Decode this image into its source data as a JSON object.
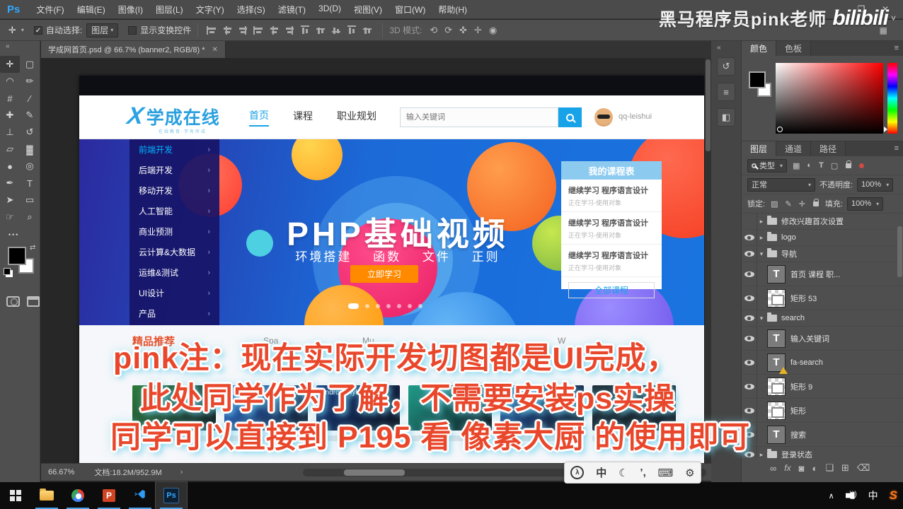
{
  "menu_bar": {
    "app_logo": "Ps",
    "items": [
      "文件(F)",
      "编辑(E)",
      "图像(I)",
      "图层(L)",
      "文字(Y)",
      "选择(S)",
      "滤镜(T)",
      "3D(D)",
      "视图(V)",
      "窗口(W)",
      "帮助(H)"
    ],
    "window_controls": [
      {
        "name": "minimize-button",
        "glyph": "–"
      },
      {
        "name": "restore-button",
        "glyph": "❐"
      },
      {
        "name": "close-button",
        "glyph": "✕"
      }
    ]
  },
  "watermark": {
    "text": "黑马程序员pink老师",
    "logo": "bilibili"
  },
  "options_bar": {
    "tool_icon": "✛",
    "auto_select_label": "自动选择:",
    "auto_select_value": "图层",
    "transform_label": "显示变换控件",
    "mode3d_label": "3D 模式:",
    "align_icons": [
      "align-top-edges-icon",
      "align-vertical-centers-icon",
      "align-bottom-edges-icon",
      "align-left-edges-icon",
      "align-horizontal-centers-icon",
      "align-right-edges-icon",
      "distribute-top-icon",
      "distribute-vertical-icon",
      "distribute-bottom-icon",
      "distribute-left-icon",
      "distribute-horizontal-icon"
    ],
    "mode3d_icons": [
      {
        "name": "rotate-3d-icon",
        "glyph": "⟲"
      },
      {
        "name": "roll-3d-icon",
        "glyph": "⟳"
      },
      {
        "name": "drag-3d-icon",
        "glyph": "✜"
      },
      {
        "name": "slide-3d-icon",
        "glyph": "✛"
      },
      {
        "name": "scale-3d-icon",
        "glyph": "◉"
      }
    ]
  },
  "toolbar": {
    "tools": [
      {
        "name": "move-tool",
        "glyph": "✛",
        "selected": true
      },
      {
        "name": "rectangular-marquee-tool",
        "glyph": "▢"
      },
      {
        "name": "lasso-tool",
        "glyph": "◠"
      },
      {
        "name": "quick-selection-tool",
        "glyph": "✏"
      },
      {
        "name": "crop-tool",
        "glyph": "#"
      },
      {
        "name": "eyedropper-tool",
        "glyph": "⁄"
      },
      {
        "name": "healing-brush-tool",
        "glyph": "✚"
      },
      {
        "name": "brush-tool",
        "glyph": "✎"
      },
      {
        "name": "clone-stamp-tool",
        "glyph": "⊥"
      },
      {
        "name": "history-brush-tool",
        "glyph": "↺"
      },
      {
        "name": "eraser-tool",
        "glyph": "▱"
      },
      {
        "name": "gradient-tool",
        "glyph": "▓"
      },
      {
        "name": "blur-tool",
        "glyph": "●"
      },
      {
        "name": "dodge-tool",
        "glyph": "◎"
      },
      {
        "name": "pen-tool",
        "glyph": "✒"
      },
      {
        "name": "type-tool",
        "glyph": "T"
      },
      {
        "name": "path-selection-tool",
        "glyph": "➤"
      },
      {
        "name": "rectangle-tool",
        "glyph": "▭"
      },
      {
        "name": "hand-tool",
        "glyph": "☞"
      },
      {
        "name": "zoom-tool",
        "glyph": "⌕"
      }
    ],
    "more": "•••"
  },
  "document_tab": {
    "title": "学成网首页.psd @ 66.7% (banner2, RGB/8) *",
    "close": "✕"
  },
  "website": {
    "logo_text": "学成在线",
    "logo_sub": "在线教育·学有所成",
    "nav": [
      {
        "label": "首页",
        "active": true
      },
      {
        "label": "课程",
        "active": false
      },
      {
        "label": "职业规划",
        "active": false
      }
    ],
    "search_placeholder": "输入关键词",
    "username": "qq-leishui",
    "banner_menu": [
      "前端开发",
      "后端开发",
      "移动开发",
      "人工智能",
      "商业预测",
      "云计算&大数据",
      "运维&测试",
      "UI设计",
      "产品"
    ],
    "banner_title": "PHP基础视频",
    "banner_subtitle": "环境搭建 函数 文件 正则",
    "banner_cta": "立即学习",
    "pagination_dots": 7,
    "course_panel": {
      "title": "我的课程表",
      "items": [
        {
          "line1": "继续学习 程序语言设计",
          "line2": "正在学习-使用对象"
        },
        {
          "line1": "继续学习 程序语言设计",
          "line2": "正在学习-使用对象"
        },
        {
          "line1": "继续学习 程序语言设计",
          "line2": "正在学习-使用对象"
        }
      ],
      "footer": "全部课程"
    },
    "section_label": "精品推荐",
    "partial_links": [
      "Spa",
      "Mu",
      "W"
    ],
    "cards": [
      {
        "color": "#2d7a3a",
        "title": ""
      },
      {
        "color": "#2f6fd8",
        "title": "Angular 2 X"
      },
      {
        "color": "#17377e",
        "title": "Android Hybrid A"
      },
      {
        "color": "#1f9d8a",
        "title": ""
      },
      {
        "color": "#275caa",
        "title": ""
      },
      {
        "color": "#20313a",
        "title": ""
      }
    ]
  },
  "color_panel": {
    "tabs": [
      "颜色",
      "色板"
    ]
  },
  "layers_panel": {
    "tabs": [
      "图层",
      "通道",
      "路径"
    ],
    "filter_label": "类型",
    "filter_icons": [
      "pixel-filter-icon",
      "adjustment-filter-icon",
      "type-filter-icon",
      "shape-filter-icon",
      "smart-object-filter-icon"
    ],
    "blend_mode": "正常",
    "opacity_label": "不透明度:",
    "opacity_value": "100%",
    "lock_label": "锁定:",
    "fill_label": "填充:",
    "fill_value": "100%",
    "layers": [
      {
        "kind": "group",
        "name": "修改兴趣首次设置",
        "eye": false,
        "expanded": false
      },
      {
        "kind": "group",
        "name": "logo",
        "eye": true,
        "expanded": false
      },
      {
        "kind": "group",
        "name": "导航",
        "eye": true,
        "expanded": true
      },
      {
        "kind": "text",
        "name": "首页  课程  职...",
        "eye": true
      },
      {
        "kind": "shape",
        "name": "矩形 53",
        "eye": true
      },
      {
        "kind": "group",
        "name": "search",
        "eye": true,
        "expanded": true
      },
      {
        "kind": "text",
        "name": "输入关键词",
        "eye": true
      },
      {
        "kind": "text",
        "name": "fa-search",
        "eye": true,
        "warning": true
      },
      {
        "kind": "shape",
        "name": "矩形 9",
        "eye": true
      },
      {
        "kind": "shape",
        "name": "矩形",
        "eye": true
      },
      {
        "kind": "text",
        "name": "搜索",
        "eye": true
      },
      {
        "kind": "group",
        "name": "登录状态",
        "eye": true,
        "expanded": false
      }
    ],
    "bottom_icons": [
      {
        "name": "link-layers-icon",
        "glyph": "∞"
      },
      {
        "name": "layer-style-icon",
        "glyph": "fx"
      },
      {
        "name": "layer-mask-icon",
        "glyph": "◙"
      },
      {
        "name": "adjustment-layer-icon",
        "glyph": "◐"
      },
      {
        "name": "new-group-icon",
        "glyph": "❏"
      },
      {
        "name": "new-layer-icon",
        "glyph": "⊞"
      },
      {
        "name": "delete-layer-icon",
        "glyph": "⌫"
      }
    ]
  },
  "status_bar": {
    "zoom_level": "66.67%",
    "doc_info": "文档:18.2M/952.9M",
    "arrow": "›"
  },
  "overlay": {
    "lines": [
      "pink注：现在实际开发切图都是UI完成，",
      "此处同学作为了解，不需要安装ps实操",
      "同学可以直接到 P195 看 像素大厨 的使用即可"
    ]
  },
  "taskbar": {
    "apps": [
      {
        "name": "start-button",
        "active": false
      },
      {
        "name": "file-explorer",
        "active": true
      },
      {
        "name": "chrome",
        "active": true
      },
      {
        "name": "powerpoint",
        "active": true,
        "label": "P"
      },
      {
        "name": "vscode",
        "active": true
      },
      {
        "name": "photoshop",
        "active": true,
        "label": "Ps"
      }
    ],
    "tray_chevron": "∧",
    "tray_ime": "中",
    "tray_sogou": "S"
  },
  "ime_bar": {
    "icons": [
      {
        "name": "sogou-logo-icon",
        "glyph": "λ"
      },
      {
        "name": "chinese-mode-icon",
        "glyph": "中"
      },
      {
        "name": "halfmoon-icon",
        "glyph": "☾"
      },
      {
        "name": "punctuation-icon",
        "glyph": "’,"
      },
      {
        "name": "soft-keyboard-icon",
        "glyph": "⌨"
      },
      {
        "name": "ime-settings-icon",
        "glyph": "⚙"
      }
    ]
  }
}
